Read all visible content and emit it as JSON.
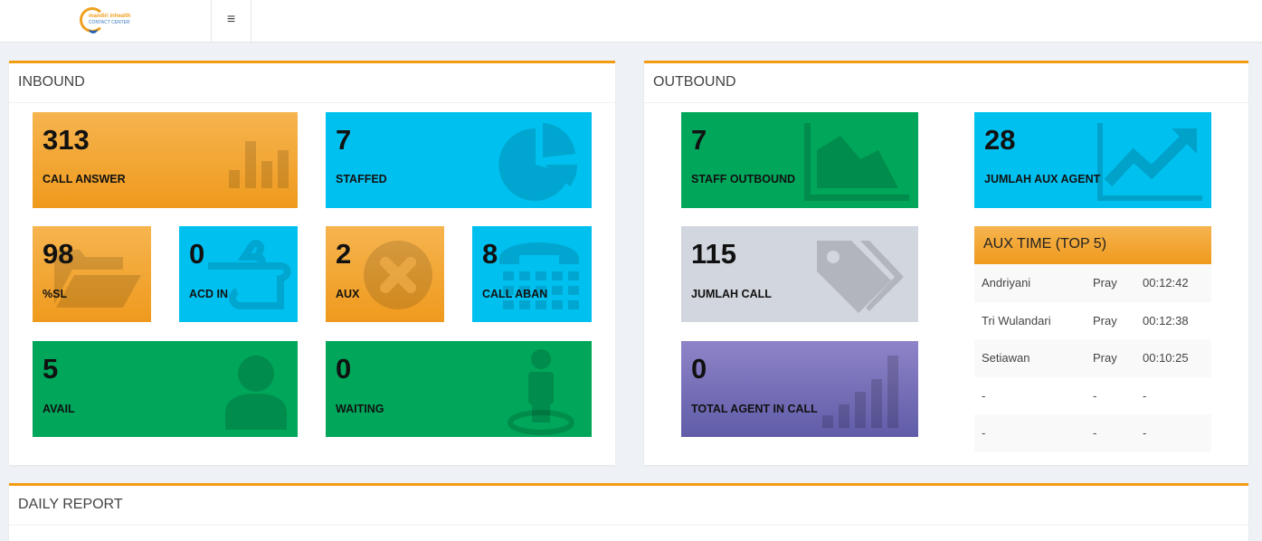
{
  "logo": {
    "line1": "mandiri inhealth",
    "line2": "CONTACT CENTER"
  },
  "menu_icon": "hamburger-icon",
  "menu_glyph": "≡",
  "inbound": {
    "title": "INBOUND",
    "tiles": [
      {
        "value": "313",
        "label": "CALL ANSWER",
        "icon": "bar-chart-icon",
        "color": "#f39c12"
      },
      {
        "value": "7",
        "label": "STAFFED",
        "icon": "pie-chart-icon",
        "color": "#00c0ef"
      },
      {
        "value": "98",
        "label": "%SL",
        "icon": "folder-open-icon",
        "color": "#f39c12"
      },
      {
        "value": "0",
        "label": "ACD IN",
        "icon": "hand-pointing-icon",
        "color": "#00c0ef"
      },
      {
        "value": "2",
        "label": "AUX",
        "icon": "times-circle-icon",
        "color": "#f39c12"
      },
      {
        "value": "8",
        "label": "CALL ABAN",
        "icon": "phone-fax-icon",
        "color": "#00c0ef"
      },
      {
        "value": "5",
        "label": "AVAIL",
        "icon": "user-icon",
        "color": "#00a65a"
      },
      {
        "value": "0",
        "label": "WAITING",
        "icon": "street-view-icon",
        "color": "#00a65a"
      }
    ]
  },
  "outbound": {
    "title": "OUTBOUND",
    "tiles": [
      {
        "value": "7",
        "label": "STAFF OUTBOUND",
        "icon": "area-chart-icon",
        "color": "#00a65a"
      },
      {
        "value": "28",
        "label": "JUMLAH AUX AGENT",
        "icon": "line-chart-icon",
        "color": "#00c0ef"
      },
      {
        "value": "115",
        "label": "JUMLAH CALL",
        "icon": "tags-icon",
        "color": "#d2d6de"
      },
      {
        "value": "0",
        "label": "TOTAL AGENT IN CALL",
        "icon": "signal-bars-icon",
        "color": "#605ca8"
      }
    ],
    "aux_time": {
      "title": "AUX TIME (TOP 5)",
      "rows": [
        {
          "name": "Andriyani",
          "status": "Pray",
          "time": "00:12:42"
        },
        {
          "name": "Tri Wulandari",
          "status": "Pray",
          "time": "00:12:38"
        },
        {
          "name": "Setiawan",
          "status": "Pray",
          "time": "00:10:25"
        },
        {
          "name": "-",
          "status": "-",
          "time": "-"
        },
        {
          "name": "-",
          "status": "-",
          "time": "-"
        }
      ]
    }
  },
  "daily_report": {
    "title": "DAILY REPORT"
  }
}
